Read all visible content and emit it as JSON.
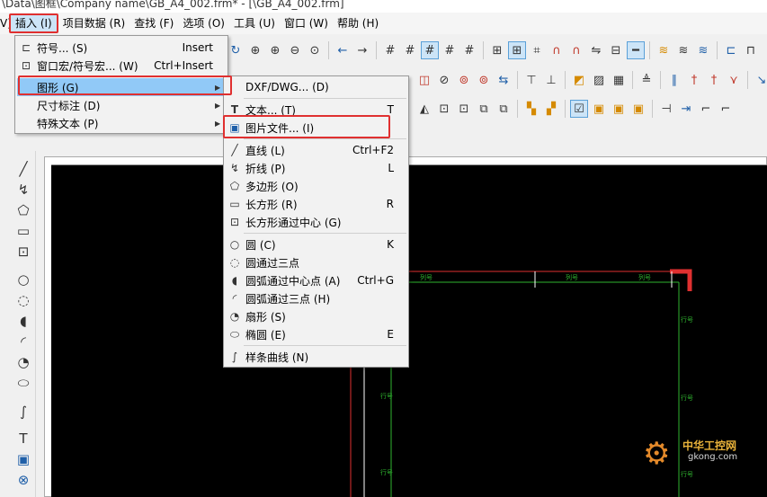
{
  "title": "\\Data\\图框\\Company name\\GB_A4_002.frm* - [\\GB_A4_002.frm]",
  "menubar": {
    "items": [
      {
        "label": "V)",
        "active": false
      },
      {
        "label": "插入 (I)",
        "active": true
      },
      {
        "label": "项目数据 (R)",
        "active": false
      },
      {
        "label": "查找 (F)",
        "active": false
      },
      {
        "label": "选项 (O)",
        "active": false
      },
      {
        "label": "工具 (U)",
        "active": false
      },
      {
        "label": "窗口 (W)",
        "active": false
      },
      {
        "label": "帮助 (H)",
        "active": false
      }
    ]
  },
  "insert_menu": {
    "items": [
      {
        "icon": "symbol-icon",
        "glyph": "⊏",
        "label": "符号... (S)",
        "shortcut": "Insert",
        "submenu": false
      },
      {
        "icon": "window-macro-icon",
        "glyph": "⊡",
        "label": "窗口宏/符号宏... (W)",
        "shortcut": "Ctrl+Insert",
        "submenu": false
      },
      {
        "icon": "",
        "glyph": "",
        "label": "图形 (G)",
        "shortcut": "",
        "submenu": true
      },
      {
        "icon": "",
        "glyph": "",
        "label": "尺寸标注 (D)",
        "shortcut": "",
        "submenu": true
      },
      {
        "icon": "",
        "glyph": "",
        "label": "特殊文本 (P)",
        "shortcut": "",
        "submenu": true
      }
    ]
  },
  "graphics_menu": {
    "items": [
      {
        "icon": "",
        "glyph": "",
        "label": "DXF/DWG... (D)",
        "shortcut": ""
      },
      {
        "icon": "text-icon",
        "glyph": "T",
        "label": "文本... (T)",
        "shortcut": "T"
      },
      {
        "icon": "image-file-icon",
        "glyph": "▣",
        "label": "图片文件... (I)",
        "shortcut": ""
      },
      {
        "icon": "line-icon",
        "glyph": "╱",
        "label": "直线 (L)",
        "shortcut": "Ctrl+F2"
      },
      {
        "icon": "polyline-icon",
        "glyph": "↯",
        "label": "折线 (P)",
        "shortcut": "L"
      },
      {
        "icon": "polygon-icon",
        "glyph": "⬠",
        "label": "多边形 (O)",
        "shortcut": ""
      },
      {
        "icon": "rectangle-icon",
        "glyph": "▭",
        "label": "长方形 (R)",
        "shortcut": "R"
      },
      {
        "icon": "rectangle-center-icon",
        "glyph": "⊡",
        "label": "长方形通过中心 (G)",
        "shortcut": ""
      },
      {
        "icon": "circle-icon",
        "glyph": "○",
        "label": "圆 (C)",
        "shortcut": "K"
      },
      {
        "icon": "circle-three-point-icon",
        "glyph": "◌",
        "label": "圆通过三点",
        "shortcut": ""
      },
      {
        "icon": "arc-center-icon",
        "glyph": "◖",
        "label": "圆弧通过中心点 (A)",
        "shortcut": "Ctrl+G"
      },
      {
        "icon": "arc-three-point-icon",
        "glyph": "◜",
        "label": "圆弧通过三点 (H)",
        "shortcut": ""
      },
      {
        "icon": "sector-icon",
        "glyph": "◔",
        "label": "扇形 (S)",
        "shortcut": ""
      },
      {
        "icon": "ellipse-icon",
        "glyph": "⬭",
        "label": "椭圆 (E)",
        "shortcut": "E"
      },
      {
        "icon": "spline-icon",
        "glyph": "∫",
        "label": "样条曲线 (N)",
        "shortcut": ""
      }
    ]
  },
  "canvas": {
    "row_label": "行号",
    "col_label": "列号"
  },
  "watermark": {
    "text": "中华工控网",
    "url": "gkong.com"
  },
  "colors": {
    "highlight": "#91c9f7",
    "callout": "#e03030",
    "frame_red": "#e03030",
    "frame_green": "#2fb52f",
    "canvas_bg": "#000000"
  }
}
